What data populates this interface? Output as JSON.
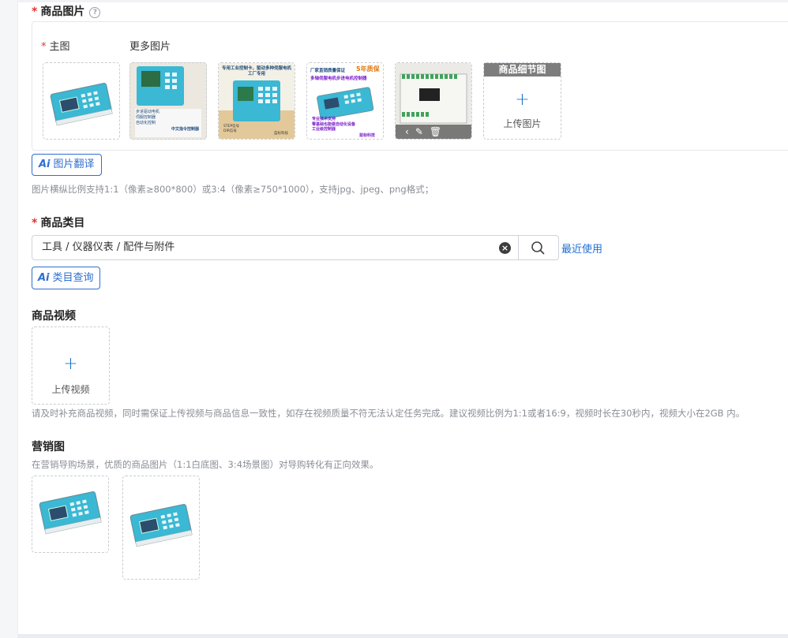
{
  "images_section": {
    "title": "商品图片",
    "help_icon": "?",
    "main_label": "主图",
    "more_label": "更多图片",
    "detail_header": "商品细节图",
    "upload_text": "上传图片",
    "plus": "+",
    "toolbar_icons": [
      "chevron-left-icon",
      "edit-icon",
      "delete-icon"
    ],
    "ai_translate_label": "图片翻译",
    "ai_mark": "Ai",
    "hint": "图片横纵比例支持1:1（像素≥800*800）或3:4（像素≥750*1000），支持jpg、jpeg、png格式；"
  },
  "thumbnail_texts": {
    "more_1_small": [
      "步进驱动电机",
      "伺服控制器",
      "自动化控制",
      "中文指令控制器"
    ],
    "more_2_headline": "专用工业控制卡，驱动多种伺服电机工厂专用",
    "more_2_lines": [
      "STEP信号",
      "DIR信号",
      "蓝标科技"
    ],
    "more_3_headline": "厂家直销质量保证",
    "more_3_number": "5年质保",
    "more_3_sub": "多轴伺服电机步进电机控制器",
    "more_3_bottom": [
      "专业技术支持",
      "零基础也能做自动化设备",
      "工业级控制器",
      "蓝标科技"
    ]
  },
  "category_section": {
    "title": "商品类目",
    "value": "工具 / 仪器仪表 / 配件与附件",
    "clear_icon": "×",
    "recent_link": "最近使用",
    "ai_query_label": "类目查询"
  },
  "video_section": {
    "title": "商品视频",
    "upload_text": "上传视频",
    "hint": "请及时补充商品视频，同时需保证上传视频与商品信息一致性，如存在视频质量不符无法认定任务完成。建议视频比例为1:1或者16:9，视频时长在30秒内，视频大小在2GB 内。"
  },
  "marketing_section": {
    "title": "营销图",
    "hint": "在营销导购场景，优质的商品图片（1:1白底图、3:4场景图）对导购转化有正向效果。"
  },
  "colors": {
    "accent": "#1f6fd6",
    "required": "#e0362f",
    "device_cyan": "#35b7d3",
    "screen": "#2d4d6e"
  }
}
